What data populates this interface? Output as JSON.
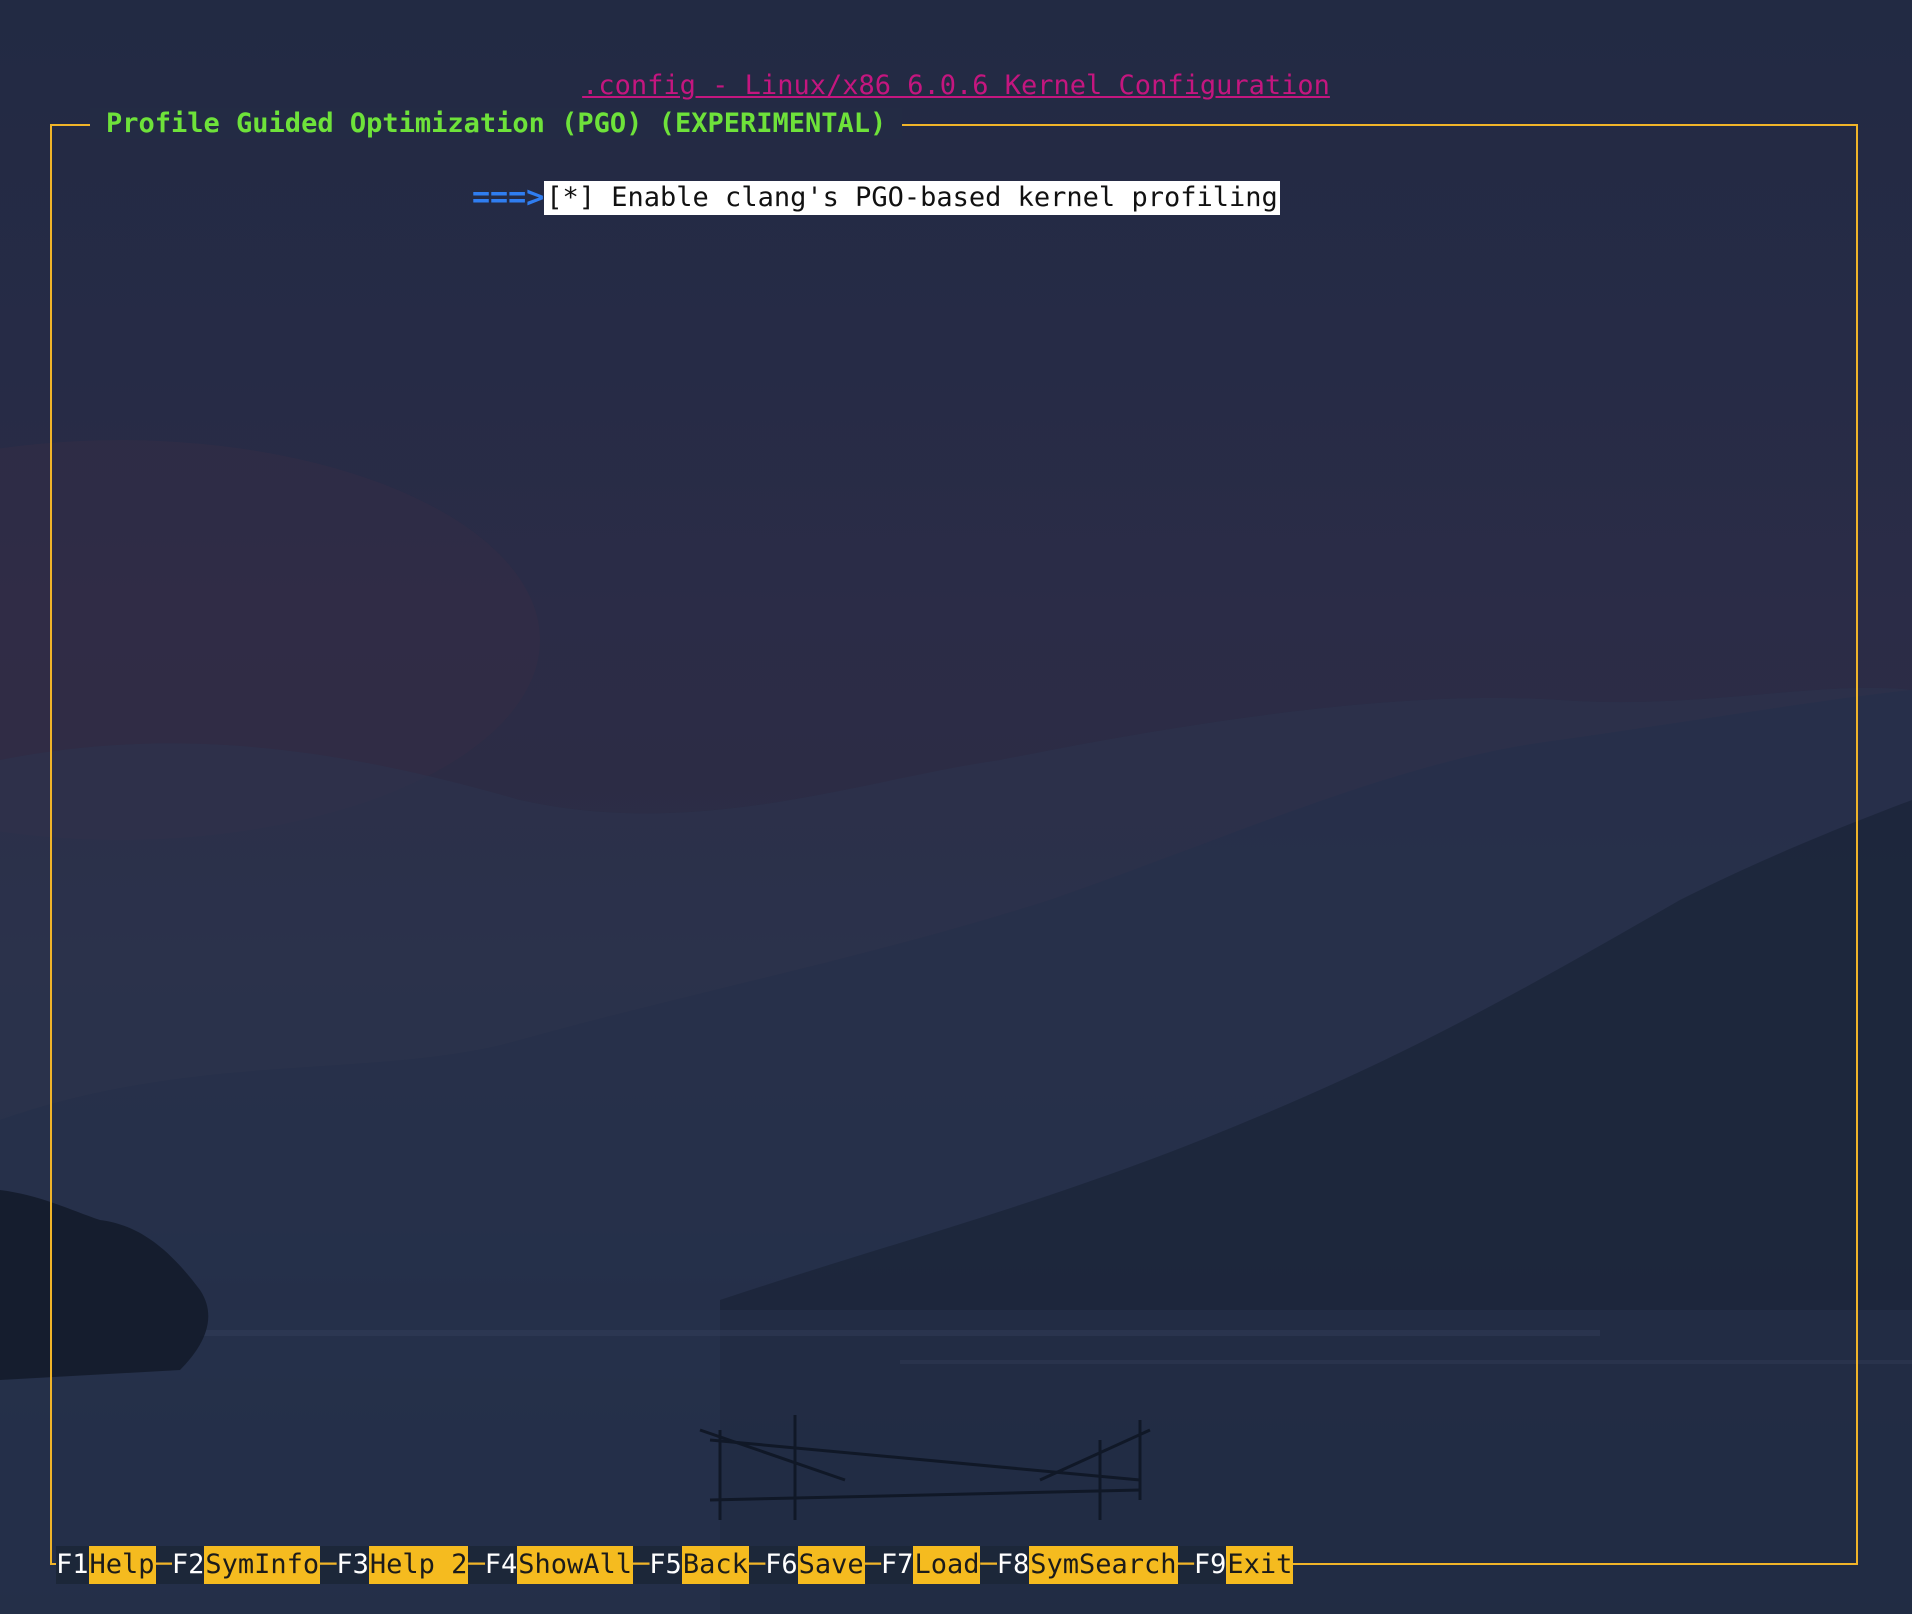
{
  "window": {
    "title": ".config - Linux/x86 6.0.6 Kernel Configuration"
  },
  "menu": {
    "title": "Profile Guided Optimization (PGO) (EXPERIMENTAL)",
    "items": [
      {
        "pointer": "===>",
        "text": "[*] Enable clang's PGO-based kernel profiling",
        "selected": true
      }
    ]
  },
  "function_keys": [
    {
      "key": "F1",
      "label": "Help"
    },
    {
      "key": "F2",
      "label": "SymInfo"
    },
    {
      "key": "F3",
      "label": "Help 2"
    },
    {
      "key": "F4",
      "label": "ShowAll"
    },
    {
      "key": "F5",
      "label": "Back"
    },
    {
      "key": "F6",
      "label": "Save"
    },
    {
      "key": "F7",
      "label": "Load"
    },
    {
      "key": "F8",
      "label": "SymSearch"
    },
    {
      "key": "F9",
      "label": "Exit"
    }
  ],
  "colors": {
    "title": "#c4167f",
    "menu_title": "#6ee23a",
    "frame": "#f0b429",
    "arrow": "#2f7df0",
    "fkey_label_bg": "#f5bb1f",
    "selection_bg": "#ffffff"
  }
}
